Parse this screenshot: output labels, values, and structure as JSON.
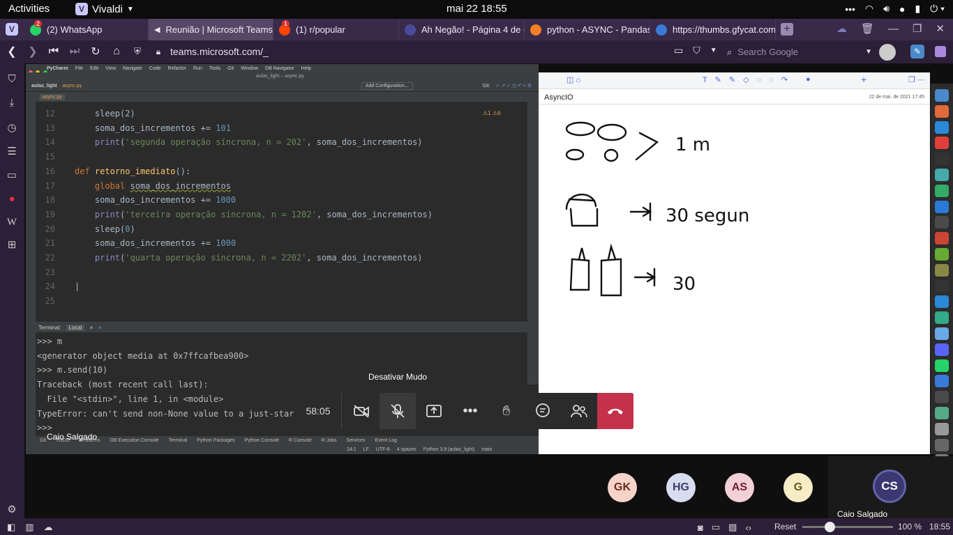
{
  "gnome": {
    "activities": "Activities",
    "app_name": "Vivaldi",
    "clock": "mai 22  18:55"
  },
  "tabs": [
    {
      "label": "(2) WhatsApp",
      "badge": "2",
      "color": "#25d366"
    },
    {
      "label": "Reunião | Microsoft Teams",
      "color": "#6264a7"
    },
    {
      "label": "(1) r/popular",
      "badge": "1",
      "color": "#ff4500"
    },
    {
      "label": "Ah Negão! - Página 4 de 68",
      "color": "#4a4a9a"
    },
    {
      "label": "python - ASYNC - Pandas re",
      "color": "#f48024"
    },
    {
      "label": "https://thumbs.gfycat.com",
      "color": "#3a7ad8"
    }
  ],
  "address": {
    "url": "teams.microsoft.com/_",
    "search_placeholder": "Search Google"
  },
  "pycharm": {
    "menu": [
      "PyCharm",
      "File",
      "Edit",
      "View",
      "Navigate",
      "Code",
      "Refactor",
      "Run",
      "Tools",
      "Git",
      "Window",
      "DB Navigator",
      "Help"
    ],
    "window_title": "aulas_light – async.py",
    "breadcrumb_project": "aulas_light",
    "breadcrumb_file": "async.py",
    "run_config": "Add Configuration...",
    "git_label": "Git:",
    "file_tab": "async.py",
    "inspection": "⚠1  ⚠6",
    "left_tools": [
      "Project",
      "DB Browser",
      "Pull Requests",
      "Structure",
      "Favorites"
    ],
    "right_tools": [
      "JuliaSciView",
      "Database",
      "SciView"
    ],
    "code_lines": [
      {
        "n": "12",
        "html": "    sleep(2)"
      },
      {
        "n": "13",
        "html": "    soma_dos_incrementos += <span class='num'>101</span>"
      },
      {
        "n": "14",
        "html": "    <span class='bi'>print</span>(<span class='str'>'segunda operação síncrona, n = 202'</span>, soma_dos_incrementos)"
      },
      {
        "n": "15",
        "html": ""
      },
      {
        "n": "16",
        "html": "<span class='kw'>def</span> <span class='fn'>retorno_imediato</span>():"
      },
      {
        "n": "17",
        "html": "    <span class='kw'>global</span> <span class='gl'>soma_dos_incrementos</span>"
      },
      {
        "n": "18",
        "html": "    soma_dos_incrementos += <span class='num'>1000</span>"
      },
      {
        "n": "19",
        "html": "    <span class='bi'>print</span>(<span class='str'>'terceira operação síncrona, n = 1202'</span>, soma_dos_incrementos)"
      },
      {
        "n": "20",
        "html": "    sleep(<span class='num'>0</span>)"
      },
      {
        "n": "21",
        "html": "    soma_dos_incrementos += <span class='num'>1000</span>"
      },
      {
        "n": "22",
        "html": "    <span class='bi'>print</span>(<span class='str'>'quarta operação síncrona, n = 2202'</span>, soma_dos_incrementos)"
      },
      {
        "n": "23",
        "html": ""
      },
      {
        "n": "24",
        "html": "|"
      },
      {
        "n": "25",
        "html": ""
      }
    ],
    "terminal_title": "Terminal:",
    "terminal_tab": "Local",
    "terminal_lines": [
      ">>> m",
      "<generator object media at 0x7ffcafbea900>",
      ">>> m.send(10)",
      "Traceback (most recent call last):",
      "  File \"<stdin>\", line 1, in <module>",
      "TypeError: can't send non-None value to a just-star",
      ">>> "
    ],
    "bottom_tools": [
      "Git",
      "TODO",
      "Problems",
      "DB Execution Console",
      "Terminal",
      "Python Packages",
      "Python Console",
      "R Console",
      "R Jobs",
      "Services",
      "Event Log"
    ],
    "status": [
      "24:1",
      "LF",
      "UTF-8",
      "4 spaces",
      "Python 3.9 (aulas_light)",
      "main"
    ]
  },
  "presenter_name": "Caio Salgado",
  "whiteboard": {
    "title": "AsyncIO",
    "date": "22 de mai. de 2021 17:45",
    "sketch_text": [
      "1 m",
      "30 segun",
      "30"
    ]
  },
  "call": {
    "timer": "58:05",
    "tooltip": "Desativar Mudo",
    "end_color": "#c4314b"
  },
  "participants": [
    {
      "initials": "GK",
      "bg": "#f6d3c9",
      "fg": "#6b2b1f"
    },
    {
      "initials": "HG",
      "bg": "#d8dcf0",
      "fg": "#3a3f6d"
    },
    {
      "initials": "AS",
      "bg": "#f3cfd6",
      "fg": "#6d2333"
    },
    {
      "initials": "G",
      "bg": "#f6ecc6",
      "fg": "#6b5a1c"
    }
  ],
  "self_tile": {
    "initials": "CS",
    "name": "Caio Salgado"
  },
  "statusbar": {
    "reset": "Reset",
    "zoom": "100 %",
    "time": "18:55",
    "zoom_level": 0.3
  }
}
